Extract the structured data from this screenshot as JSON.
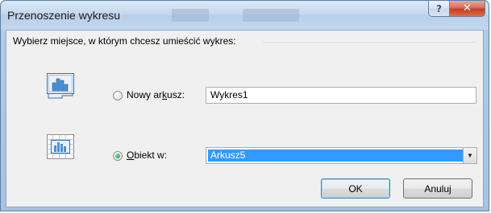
{
  "window": {
    "title": "Przenoszenie wykresu",
    "help_symbol": "?",
    "close_symbol": "✕"
  },
  "dialog": {
    "prompt": "Wybierz miejsce, w którym chcesz umieścić wykres:",
    "new_sheet": {
      "label_pre": "Nowy ar",
      "label_mnemonic": "k",
      "label_post": "usz:",
      "value": "Wykres1",
      "selected": false
    },
    "object_in": {
      "label_mnemonic": "O",
      "label_post": "biekt w:",
      "value": "Arkusz5",
      "selected": true
    },
    "ok_label": "OK",
    "cancel_label": "Anuluj"
  },
  "colors": {
    "selection": "#3399ff",
    "radio_checked": "#128c3b"
  }
}
